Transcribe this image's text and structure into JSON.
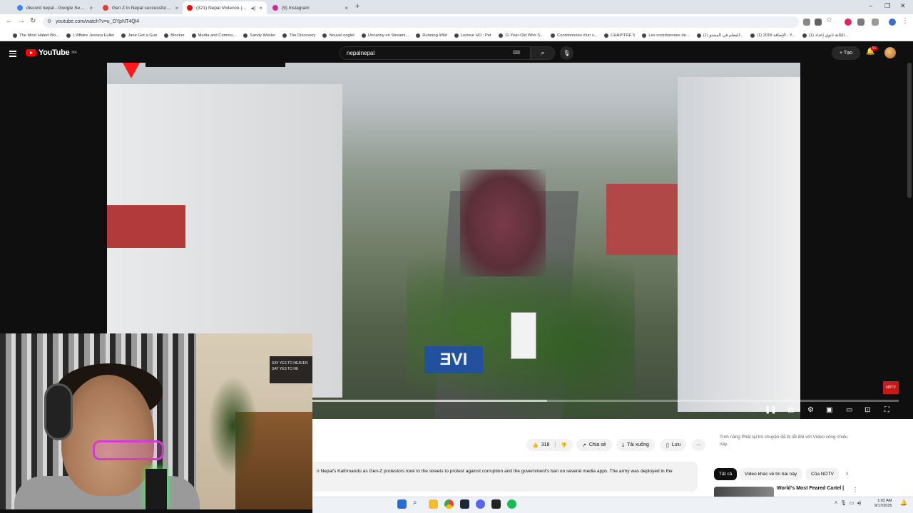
{
  "browser": {
    "tabs": [
      {
        "title": "discord nepal - Google Search",
        "color": "#4285f4"
      },
      {
        "title": "Gen Z in Nepal successfully ov...",
        "color": "#e53935"
      },
      {
        "title": "(321) Nepal Violence | Dron...",
        "color": "#ff0000"
      },
      {
        "title": "(9) Instagram",
        "color": "#d6249f"
      }
    ],
    "url": "youtube.com/watch?v=u_OYpNT4Ql4",
    "bookmarks": [
      "The Most Hated Wo...",
      "L'Affaire Jessica Fuller",
      "Jane Got a Gun",
      "Blocker",
      "Media and Commu...",
      "Sandy Wexler",
      "The Discovery",
      "Nouvel onglet",
      "Uncanny en Streami...",
      "Running Wild",
      "Lecteur HD : Pet",
      "11-Year-Old Who S...",
      "Coordonnées d'un v...",
      "CHAPITRE 5",
      "Les coordonnées de...",
      "(1) المعلم في المستو...",
      "(1) الإضافة 2018 - Y...",
      "(1) الثالثة ثانوي إعداد..."
    ]
  },
  "youtube": {
    "logo": "YouTube",
    "region": "MA",
    "search_query": "nepalnepal",
    "create_label": "Tạo",
    "notif_count": "9+"
  },
  "video": {
    "overlay_logo": "ƎVI",
    "channel_bug": "NDTV",
    "played_fraction": 0.0,
    "buffered_fraction": 0.4
  },
  "actions": {
    "likes": "318",
    "share": "Chia sẻ",
    "download": "Tải xuống",
    "save": "Lưu"
  },
  "description": "n Nepal's Kathmandu as Gen-Z protestors took to the streets to protest against corruption and the government's ban on several media apps. The army was deployed in the",
  "sidebar": {
    "notice": "Tính năng Phát lại trò chuyện đã bị tắt đối với Video công chiếu này.",
    "chips": [
      "Tất cả",
      "Video khác về tin bài này",
      "Của NDTV"
    ],
    "rec_title": "World's Most Feared Cartel |"
  },
  "webcam": {
    "sign_text": "SAY YES TO HEAVEN SAY YES TO HE"
  },
  "taskbar": {
    "time": "1:02 AM",
    "date": "9/17/2025"
  }
}
